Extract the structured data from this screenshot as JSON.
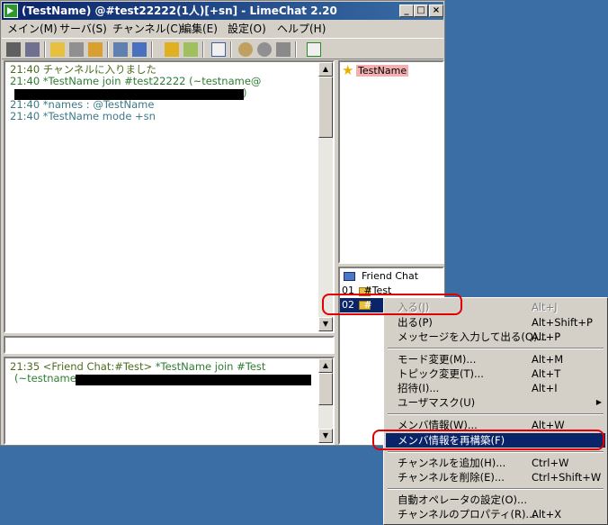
{
  "window": {
    "title": "(TestName) @#test22222(1人)[+sn]  - LimeChat 2.20"
  },
  "menu": [
    "メイン(M)",
    "サーバ(S)",
    "チャンネル(C)",
    "編集(E)",
    "設定(O)",
    "ヘルプ(H)"
  ],
  "log": {
    "line1": "21:40 チャンネルに入りました",
    "line2": "21:40 *TestName join #test22222 (~testname@",
    "line2b": ")",
    "line3": "21:40 *names : @TestName",
    "line4": "21:40 *TestName mode +sn"
  },
  "members": [
    {
      "name": "TestName",
      "icon": "star-icon"
    }
  ],
  "server_log": {
    "line1_prefix": "21:35 <Friend Chat:#Test> ",
    "line1_msg": "*TestName join #Test",
    "line2": "(~testname@"
  },
  "channels": [
    {
      "label": "Friend Chat",
      "icon": "computer-icon"
    },
    {
      "label": "01   #Test",
      "icon": "folder-icon"
    },
    {
      "label": "02   #",
      "icon": "folder-icon"
    }
  ],
  "context_menu": [
    {
      "label": "入る(J)",
      "shortcut": "Alt+J",
      "disabled": true
    },
    {
      "label": "出る(P)",
      "shortcut": "Alt+Shift+P"
    },
    {
      "label": "メッセージを入力して出る(Q)...",
      "shortcut": "Alt+P"
    },
    {
      "label": "モード変更(M)...",
      "shortcut": "Alt+M"
    },
    {
      "label": "トピック変更(T)...",
      "shortcut": "Alt+T"
    },
    {
      "label": "招待(I)...",
      "shortcut": "Alt+I"
    },
    {
      "label": "ユーザマスク(U)",
      "shortcut": ""
    },
    {
      "label": "メンバ情報(W)...",
      "shortcut": "Alt+W"
    },
    {
      "label": "メンバ情報を再構築(F)",
      "shortcut": "",
      "highlighted": true
    },
    {
      "label": "チャンネルを追加(H)...",
      "shortcut": "Ctrl+W"
    },
    {
      "label": "チャンネルを削除(E)...",
      "shortcut": "Ctrl+Shift+W"
    },
    {
      "label": "自動オペレータの設定(O)...",
      "shortcut": ""
    },
    {
      "label": "チャンネルのプロパティ(R)...",
      "shortcut": "Alt+X"
    }
  ],
  "colors": {
    "desktop": "#3a6ea5",
    "title": "#0a246a",
    "selection": "#0a246a",
    "annotation": "#e00000"
  }
}
